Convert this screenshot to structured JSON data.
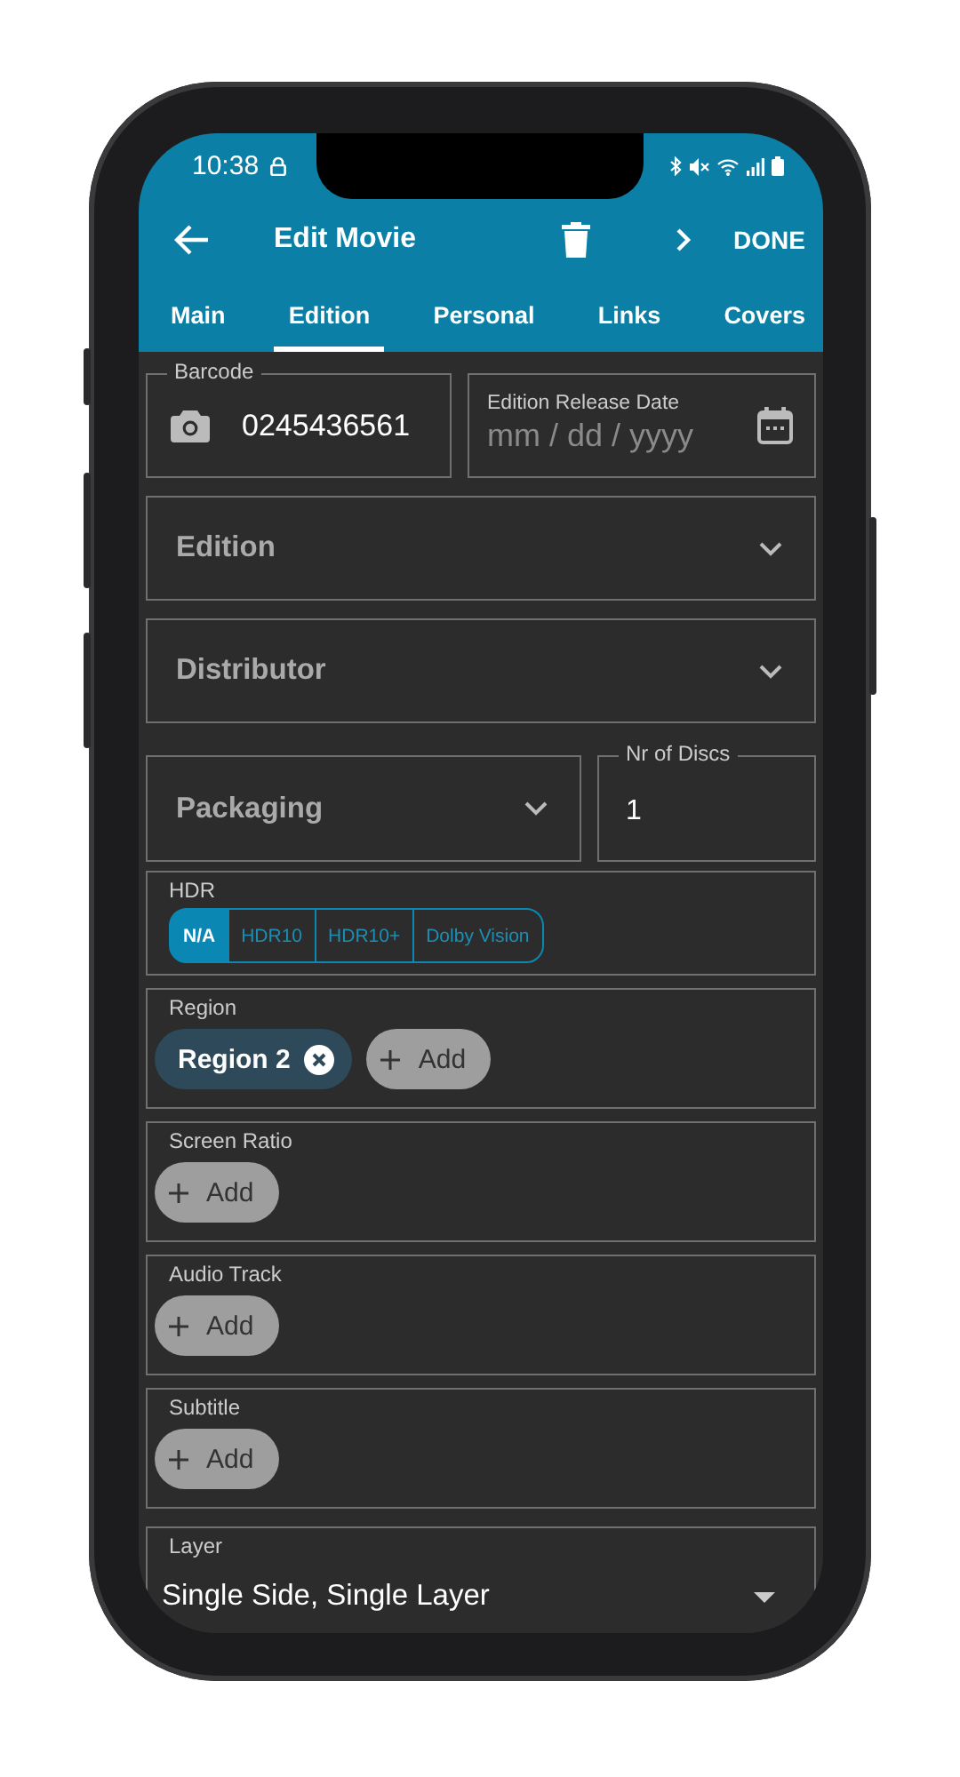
{
  "status_bar": {
    "time": "10:38"
  },
  "toolbar": {
    "title": "Edit Movie",
    "action": "DONE"
  },
  "tabs": [
    {
      "label": "Main",
      "selected": false
    },
    {
      "label": "Edition",
      "selected": true
    },
    {
      "label": "Personal",
      "selected": false
    },
    {
      "label": "Links",
      "selected": false
    },
    {
      "label": "Covers",
      "selected": false
    }
  ],
  "barcode": {
    "label": "Barcode",
    "value": "0245436561"
  },
  "release_date": {
    "label": "Edition Release Date",
    "placeholder": "mm / dd / yyyy"
  },
  "dropdowns": [
    {
      "label": "Edition"
    },
    {
      "label": "Distributor"
    }
  ],
  "packaging": {
    "label": "Packaging"
  },
  "discs": {
    "label": "Nr of Discs",
    "value": "1"
  },
  "hdr": {
    "label": "HDR",
    "options": [
      {
        "label": "N/A",
        "selected": true
      },
      {
        "label": "HDR10",
        "selected": false
      },
      {
        "label": "HDR10+",
        "selected": false
      },
      {
        "label": "Dolby Vision",
        "selected": false
      }
    ]
  },
  "chip_fields": [
    {
      "label": "Region",
      "chips": [
        "Region 2"
      ],
      "add": "Add"
    },
    {
      "label": "Screen Ratio",
      "add": "Add"
    },
    {
      "label": "Audio Track",
      "add": "Add"
    },
    {
      "label": "Subtitle",
      "add": "Add"
    }
  ],
  "layer": {
    "label": "Layer",
    "value": "Single Side, Single Layer"
  }
}
